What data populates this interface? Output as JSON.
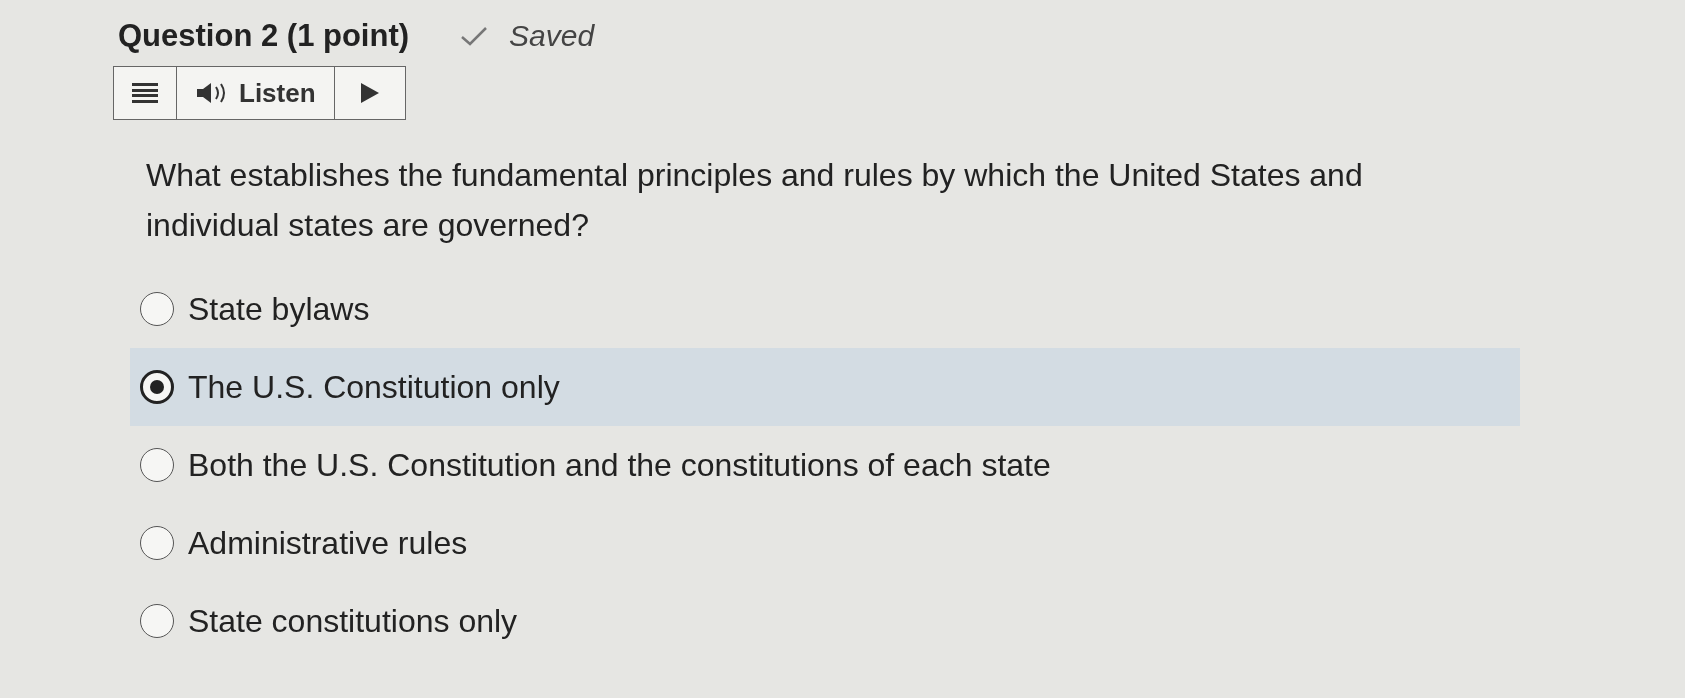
{
  "question": {
    "title": "Question 2 (1 point)",
    "status": "Saved",
    "saved": true
  },
  "toolbar": {
    "listen_label": "Listen"
  },
  "prompt": "What establishes the fundamental principles and rules by which the United States and individual states are governed?",
  "options": [
    {
      "label": "State bylaws",
      "selected": false
    },
    {
      "label": "The U.S. Constitution only",
      "selected": true
    },
    {
      "label": "Both the U.S. Constitution and the constitutions of each state",
      "selected": false
    },
    {
      "label": "Administrative rules",
      "selected": false
    },
    {
      "label": "State constitutions only",
      "selected": false
    }
  ]
}
